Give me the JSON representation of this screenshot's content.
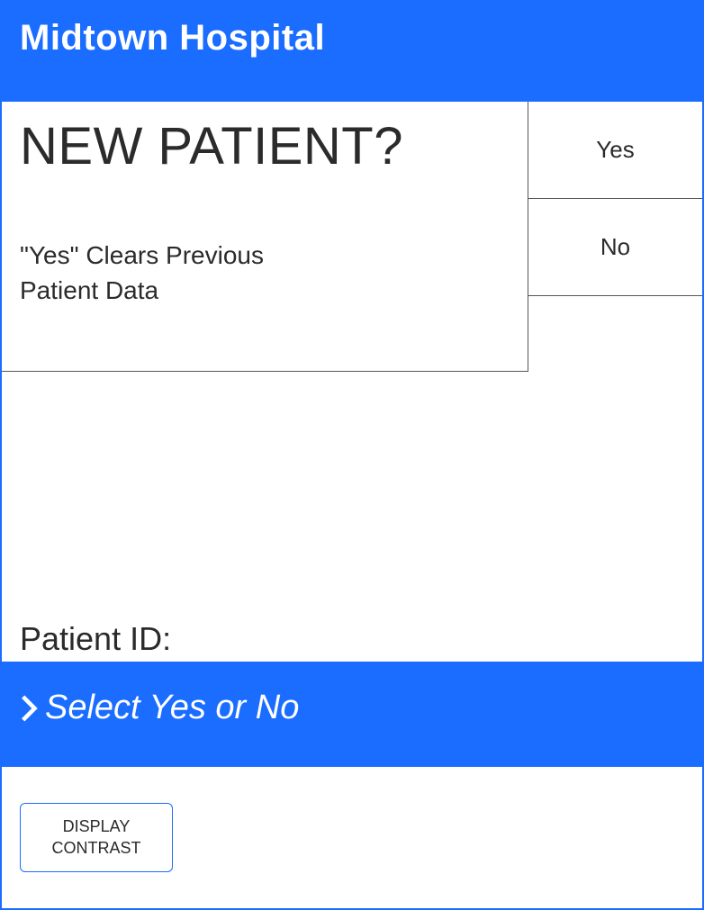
{
  "header": {
    "title": "Midtown Hospital"
  },
  "question": {
    "title": "NEW PATIENT?",
    "subtitle_line1": "\"Yes\" Clears Previous",
    "subtitle_line2": "Patient Data"
  },
  "buttons": {
    "yes": "Yes",
    "no": "No"
  },
  "patient_id": {
    "label": "Patient ID:"
  },
  "prompt": {
    "text": "Select Yes or No"
  },
  "contrast_button": {
    "line1": "DISPLAY",
    "line2": "CONTRAST"
  },
  "colors": {
    "primary": "#1a6dff",
    "text": "#2b2b2b",
    "border": "#555"
  }
}
